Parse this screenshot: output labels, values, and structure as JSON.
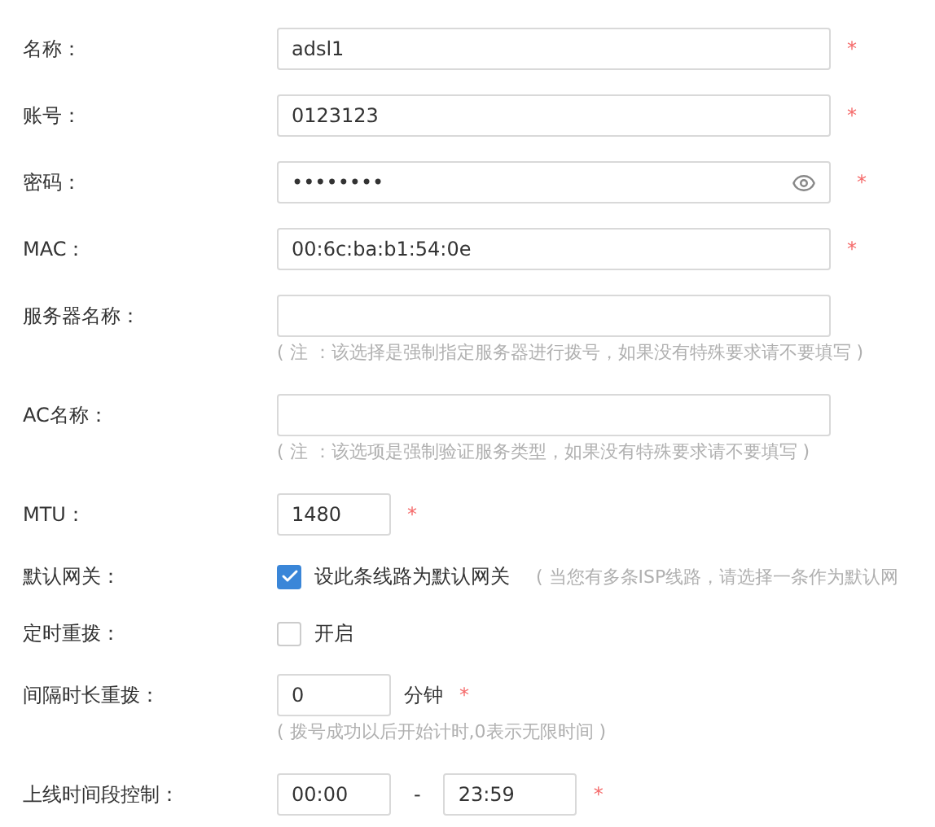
{
  "rows": [
    {
      "kind": "text",
      "label": "名称：",
      "value": "adsl1",
      "mark": "*"
    },
    {
      "kind": "text",
      "label": "账号：",
      "value": "0123123",
      "mark": "*"
    },
    {
      "kind": "password",
      "label": "密码：",
      "value": "••••••••",
      "mark": "*"
    },
    {
      "kind": "text",
      "label": "MAC：",
      "value": "00:6c:ba:b1:54:0e",
      "mark": "*"
    },
    {
      "kind": "text",
      "label": "服务器名称：",
      "note": "( 注 ：该选择是强制指定服务器进行拨号，如果没有特殊要求请不要填写 )"
    },
    {
      "kind": "text",
      "label": "AC名称：",
      "note": "( 注 ：该选项是强制验证服务类型，如果没有特殊要求请不要填写 )"
    },
    {
      "kind": "short",
      "label": "MTU：",
      "value": "1480",
      "mark": "*"
    },
    {
      "kind": "checkbox",
      "label": "默认网关：",
      "text": "设此条线路为默认网关",
      "checked": true,
      "hint": "( 当您有多条ISP线路，请选择一条作为默认网"
    },
    {
      "kind": "checkbox",
      "label": "定时重拨：",
      "text": "开启",
      "checked": false
    },
    {
      "kind": "short",
      "label": "间隔时长重拨：",
      "value": "0",
      "unit": "分钟",
      "mark": "*",
      "note": "( 拨号成功以后开始计时,0表示无限时间 )"
    },
    {
      "kind": "range",
      "label": "上线时间段控制：",
      "from": "00:00",
      "separator": "-",
      "to": "23:59",
      "mark": "*"
    }
  ]
}
